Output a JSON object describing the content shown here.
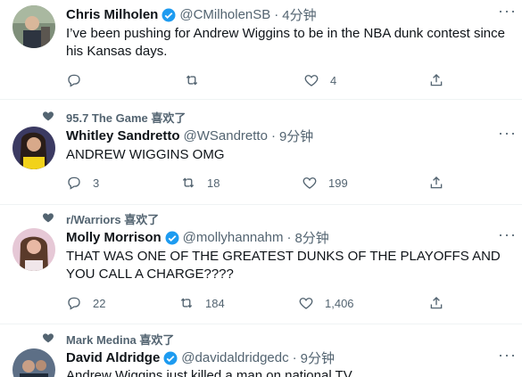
{
  "colors": {
    "text": "#0f1419",
    "secondary": "#536471",
    "verified": "#1d9bf0",
    "divider": "#eff3f4"
  },
  "tweets": [
    {
      "name": "Chris Milholen",
      "handle": "@CMilholenSB",
      "time": "4分钟",
      "text": "I’ve been pushing for Andrew Wiggins to be in the NBA dunk contest since his Kansas days.",
      "replies": "",
      "retweets": "",
      "likes": "4",
      "more": "···"
    },
    {
      "social": "95.7 The Game 喜欢了",
      "name": "Whitley Sandretto",
      "handle": "@WSandretto",
      "time": "9分钟",
      "text": "ANDREW WIGGINS OMG",
      "replies": "3",
      "retweets": "18",
      "likes": "199",
      "more": "···"
    },
    {
      "social": "r/Warriors 喜欢了",
      "name": "Molly Morrison",
      "handle": "@mollyhannahm",
      "time": "8分钟",
      "text": "THAT WAS ONE OF THE GREATEST DUNKS OF THE PLAYOFFS AND YOU CALL A CHARGE????",
      "replies": "22",
      "retweets": "184",
      "likes": "1,406",
      "more": "···"
    },
    {
      "social": "Mark Medina 喜欢了",
      "name": "David Aldridge",
      "handle": "@davidaldridgedc",
      "time": "9分钟",
      "text": "Andrew Wiggins just killed a man on national TV",
      "more": "···"
    }
  ],
  "sep": "·"
}
